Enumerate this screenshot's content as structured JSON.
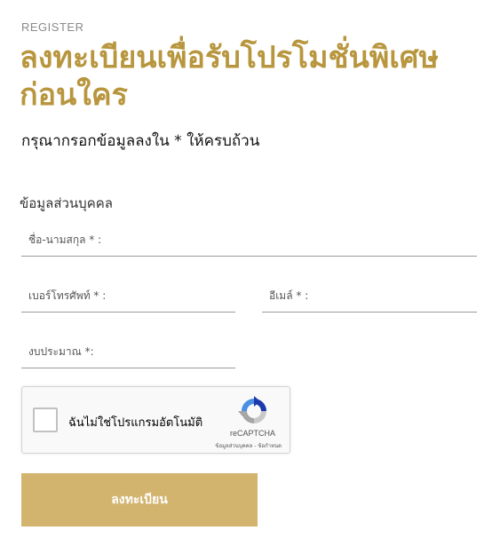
{
  "header": {
    "eyebrow": "REGISTER",
    "title": "ลงทะเบียนเพื่อรับโปรโมชั่นพิเศษก่อนใคร",
    "subtitle": "กรุณากรอกข้อมูลลงใน * ให้ครบถ้วน"
  },
  "form": {
    "section_title": "ข้อมูลส่วนบุคคล",
    "name_placeholder": "ชื่อ-นามสกุล * :",
    "phone_placeholder": "เบอร์โทรศัพท์ * :",
    "email_placeholder": "อีเมล์ * :",
    "budget_placeholder": "งบประมาณ *:"
  },
  "recaptcha": {
    "label": "ฉันไม่ใช่โปรแกรมอัตโนมัติ",
    "brand": "reCAPTCHA",
    "privacy": "ข้อมูลส่วนบุคคล",
    "separator": " - ",
    "terms": "ข้อกำหนด"
  },
  "submit_label": "ลงทะเบียน",
  "colors": {
    "accent": "#b8963e",
    "button": "#d2b46f"
  }
}
